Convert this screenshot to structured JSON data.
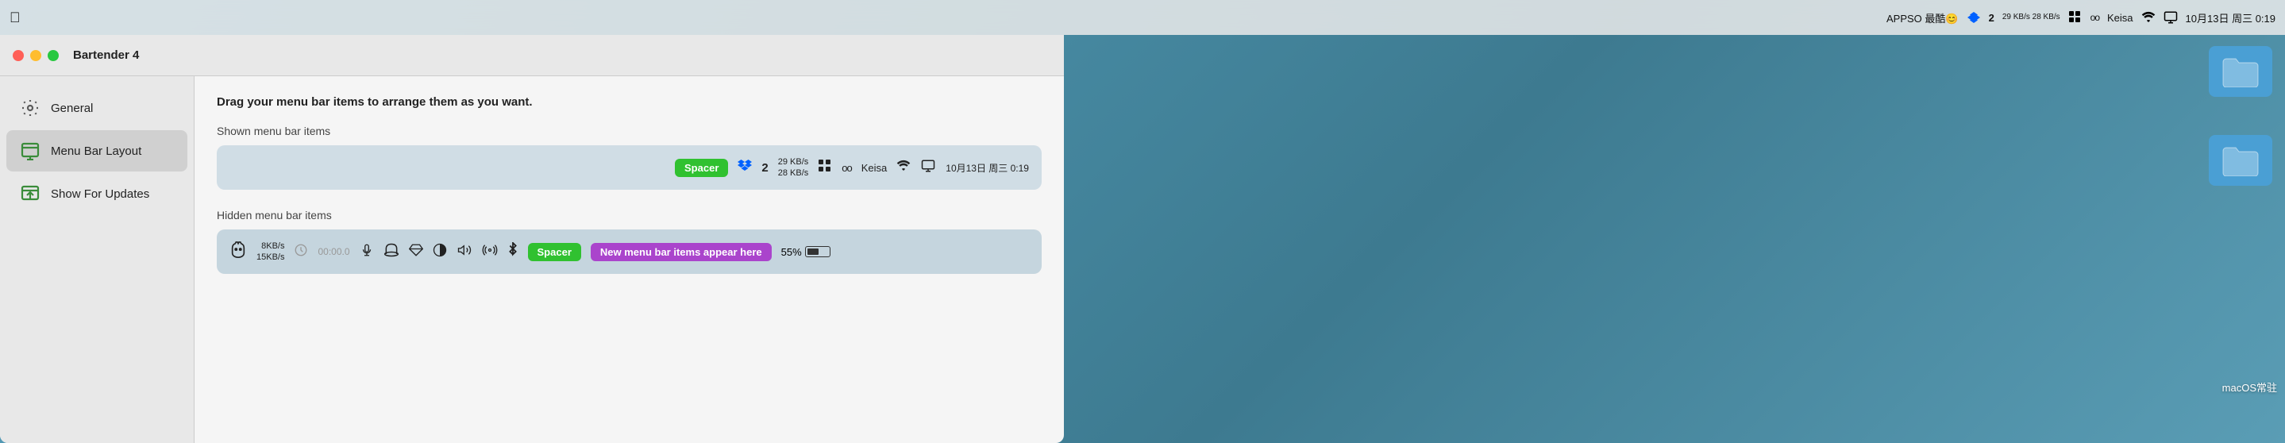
{
  "menubar": {
    "apple_symbol": "",
    "right_items": {
      "appso_label": "APPSO 最酷😊",
      "dropbox_icon": "dropbox-icon",
      "number2_icon": "2",
      "speed": "29 KB/s\n28 KB/s",
      "grid_icon": "grid-icon",
      "glasses_icon": "oo-icon",
      "keisa_label": "Keisa",
      "wifi_icon": "wifi-icon",
      "display_icon": "display-icon",
      "datetime": "10月13日 周三 0:19"
    }
  },
  "window": {
    "title": "Bartender 4",
    "traffic_lights": {
      "close": "close",
      "minimize": "minimize",
      "maximize": "maximize"
    }
  },
  "sidebar": {
    "items": [
      {
        "id": "general",
        "label": "General",
        "icon": "gear-icon"
      },
      {
        "id": "menu-bar-layout",
        "label": "Menu Bar Layout",
        "icon": "menubar-icon",
        "active": true
      },
      {
        "id": "show-for-updates",
        "label": "Show For Updates",
        "icon": "update-icon"
      }
    ]
  },
  "content": {
    "drag_hint": "Drag your menu bar items to arrange them as you want.",
    "shown_section": {
      "label": "Shown menu bar items",
      "items": [
        {
          "type": "spacer",
          "label": "Spacer"
        },
        {
          "type": "icon",
          "name": "dropbox-icon",
          "symbol": "💧"
        },
        {
          "type": "icon",
          "name": "number2-icon",
          "symbol": "2"
        },
        {
          "type": "text",
          "label": "29 KB/s\n28 KB/s"
        },
        {
          "type": "icon",
          "name": "grid-icon",
          "symbol": "⊞"
        },
        {
          "type": "icon",
          "name": "glasses-icon",
          "symbol": "oo"
        },
        {
          "type": "text",
          "label": "Keisa"
        },
        {
          "type": "icon",
          "name": "wifi-icon",
          "symbol": "wifi"
        },
        {
          "type": "icon",
          "name": "display-icon",
          "symbol": "⬛"
        },
        {
          "type": "text",
          "label": "10月13日 周三 0:19"
        }
      ]
    },
    "hidden_section": {
      "label": "Hidden menu bar items",
      "items": [
        {
          "type": "icon",
          "name": "cat-icon",
          "symbol": "🐱"
        },
        {
          "type": "text",
          "label": "8KB/s\n15KB/s"
        },
        {
          "type": "text",
          "label": "00:00.0"
        },
        {
          "type": "icon",
          "name": "handshake-icon",
          "symbol": "🤝"
        },
        {
          "type": "icon",
          "name": "hat-icon",
          "symbol": "🎩"
        },
        {
          "type": "icon",
          "name": "diamond-icon",
          "symbol": "💎"
        },
        {
          "type": "icon",
          "name": "circle-icon",
          "symbol": "◑"
        },
        {
          "type": "icon",
          "name": "volume-icon",
          "symbol": "🔊"
        },
        {
          "type": "icon",
          "name": "signal-icon",
          "symbol": "📡"
        },
        {
          "type": "icon",
          "name": "bluetooth-icon",
          "symbol": "✱"
        },
        {
          "type": "spacer",
          "label": "Spacer"
        },
        {
          "type": "badge",
          "label": "New menu bar items appear here"
        },
        {
          "type": "battery",
          "percent": "55%",
          "level": 0.55
        }
      ]
    }
  },
  "desktop": {
    "folders": [
      {
        "id": "folder1",
        "label": ""
      },
      {
        "id": "folder2",
        "label": ""
      },
      {
        "id": "macos-label",
        "label": "macOS常驻"
      }
    ]
  }
}
